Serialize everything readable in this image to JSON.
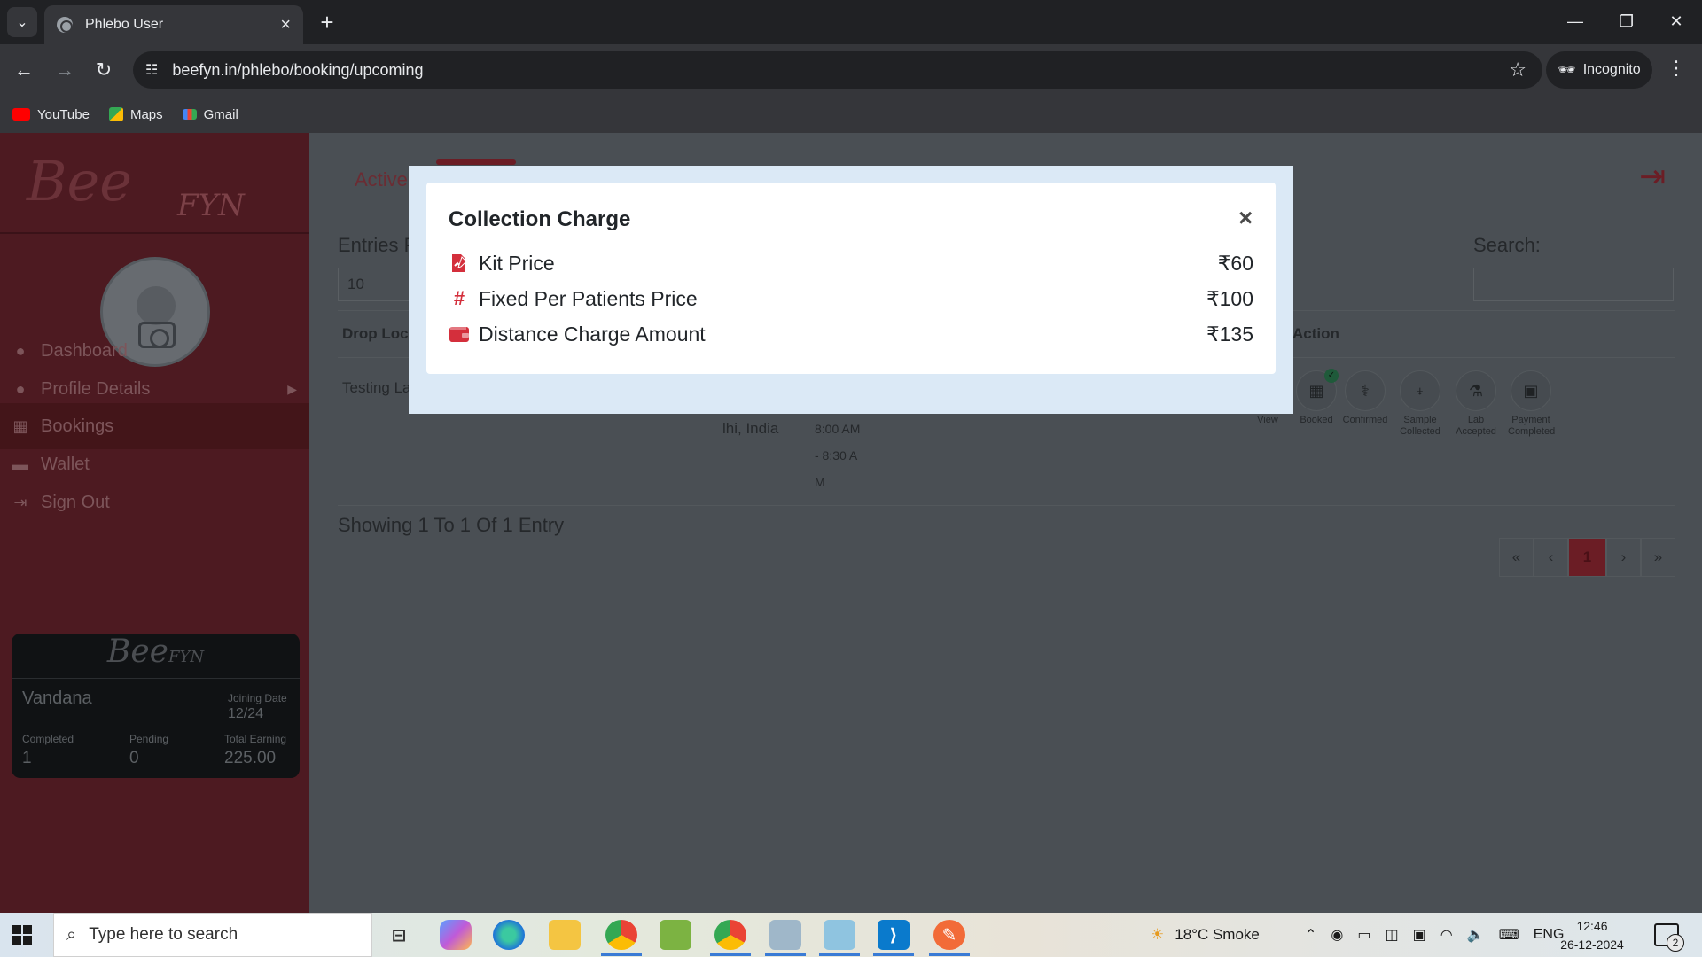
{
  "browser": {
    "tab_title": "Phlebo User",
    "tab_close": "×",
    "new_tab": "+",
    "url": "beefyn.in/phlebo/booking/upcoming",
    "incognito_label": "Incognito",
    "bookmarks": [
      {
        "label": "YouTube",
        "icon": "youtube-icon",
        "color": "#ff0000"
      },
      {
        "label": "Maps",
        "icon": "maps-icon",
        "color": "#34a853"
      },
      {
        "label": "Gmail",
        "icon": "gmail-icon",
        "color": "#ea4335"
      }
    ]
  },
  "sidebar": {
    "logo_script": "Bee",
    "logo_suffix": "FYN",
    "items": [
      {
        "label": "Dashboard",
        "icon": "palette-icon"
      },
      {
        "label": "Profile Details",
        "icon": "user-icon"
      },
      {
        "label": "Bookings",
        "icon": "calendar-icon"
      },
      {
        "label": "Wallet",
        "icon": "wallet-icon"
      },
      {
        "label": "Sign Out",
        "icon": "sign-out-icon"
      }
    ],
    "card": {
      "logo_script": "Bee",
      "logo_suffix": "FYN",
      "name": "Vandana",
      "joining_date_label": "Joining Date",
      "joining_date": "12/24",
      "completed_label": "Completed",
      "completed": "1",
      "pending_label": "Pending",
      "pending": "0",
      "total_earning_label": "Total Earning",
      "total_earning": "225.00"
    }
  },
  "content": {
    "active_tab": "Active",
    "entries_label": "Entries P",
    "entries_value": "10",
    "search_label": "Search:",
    "columns": {
      "drop_location": "Drop Loca",
      "action": "Action"
    },
    "row": {
      "drop_location": "Testing La",
      "address": "lhi, India",
      "time_1": "8:00 AM",
      "time_2": "- 8:30 A",
      "time_3": "M"
    },
    "actions": [
      {
        "label": "View",
        "icon": "eye-icon"
      },
      {
        "label": "Booked",
        "icon": "calendar-check-icon"
      },
      {
        "label": "Confirmed",
        "icon": "stethoscope-icon"
      },
      {
        "label": "Sample Collected",
        "icon": "sample-icon"
      },
      {
        "label": "Lab Accepted",
        "icon": "flask-icon"
      },
      {
        "label": "Payment Completed",
        "icon": "money-icon"
      }
    ],
    "showing_text": "Showing 1 To 1 Of 1 Entry",
    "pagination": [
      "«",
      "‹",
      "1",
      "›",
      "»"
    ]
  },
  "modal": {
    "title": "Collection Charge",
    "close": "×",
    "rows": [
      {
        "label": "Kit Price",
        "value": "₹60",
        "icon": "kit-icon"
      },
      {
        "label": "Fixed Per Patients Price",
        "value": "₹100",
        "icon": "hash-icon"
      },
      {
        "label": "Distance Charge Amount",
        "value": "₹135",
        "icon": "wallet-icon"
      }
    ],
    "accent_color": "#d42f3c"
  },
  "taskbar": {
    "search_placeholder": "Type here to search",
    "weather": "18°C  Smoke",
    "language": "ENG",
    "time": "12:46",
    "date": "26-12-2024",
    "notification_count": "2"
  }
}
